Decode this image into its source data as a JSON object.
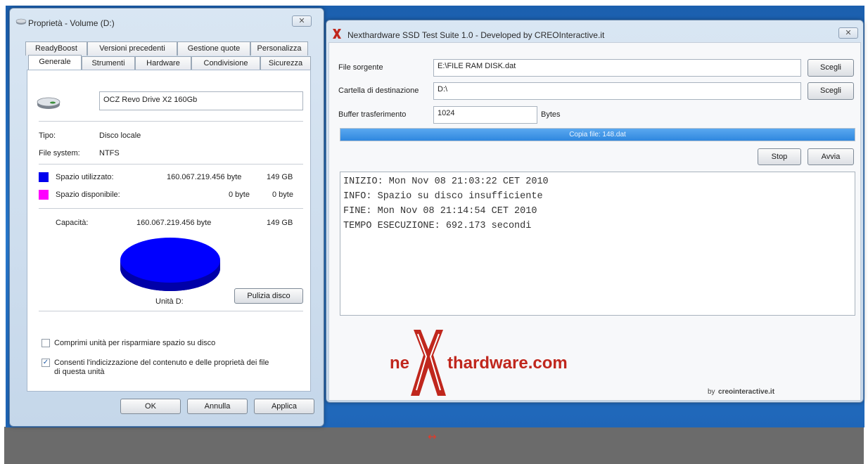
{
  "properties": {
    "title": "Proprietà - Volume (D:)",
    "close": "✕",
    "tabs_back": [
      "ReadyBoost",
      "Versioni precedenti",
      "Gestione quote",
      "Personalizza"
    ],
    "tabs_front": [
      "Generale",
      "Strumenti",
      "Hardware",
      "Condivisione",
      "Sicurezza"
    ],
    "volume_name": "OCZ Revo Drive X2 160Gb",
    "type_label": "Tipo:",
    "type_value": "Disco locale",
    "fs_label": "File system:",
    "fs_value": "NTFS",
    "used_label": "Spazio utilizzato:",
    "used_bytes": "160.067.219.456 byte",
    "used_gb": "149 GB",
    "free_label": "Spazio disponibile:",
    "free_bytes": "0 byte",
    "free_gb": "0 byte",
    "capacity_label": "Capacità:",
    "capacity_bytes": "160.067.219.456 byte",
    "capacity_gb": "149 GB",
    "drive_label": "Unità D:",
    "cleanup_button": "Pulizia disco",
    "compress_label": "Comprimi unità per risparmiare spazio su disco",
    "compress_checked": false,
    "index_label_1": "Consenti l'indicizzazione del contenuto e delle proprietà dei file",
    "index_label_2": "di questa unità",
    "index_checked": true,
    "ok": "OK",
    "cancel": "Annulla",
    "apply": "Applica",
    "colors": {
      "used": "#0000ee",
      "free": "#ff00ff"
    }
  },
  "ssd": {
    "title": "Nexthardware SSD Test Suite 1.0 - Developed by CREOInteractive.it",
    "close": "✕",
    "source_label": "File sorgente",
    "source_value": "E:\\FILE RAM DISK.dat",
    "dest_label": "Cartella di destinazione",
    "dest_value": "D:\\",
    "choose": "Scegli",
    "buffer_label": "Buffer trasferimento",
    "buffer_value": "1024",
    "buffer_unit": "Bytes",
    "progress_text": "Copia file: 148.dat",
    "progress": 1.0,
    "stop": "Stop",
    "start": "Avvia",
    "log": [
      "INIZIO: Mon Nov 08 21:03:22 CET 2010",
      "INFO: Spazio su disco insufficiente",
      "FINE: Mon Nov 08 21:14:54 CET 2010",
      "TEMPO ESECUZIONE: 692.173 secondi"
    ],
    "logo_ne": "ne",
    "logo_rest": "thardware.com",
    "logo_by": "by",
    "logo_creo": "creointeractive.it"
  },
  "resize_glyph": "↔"
}
